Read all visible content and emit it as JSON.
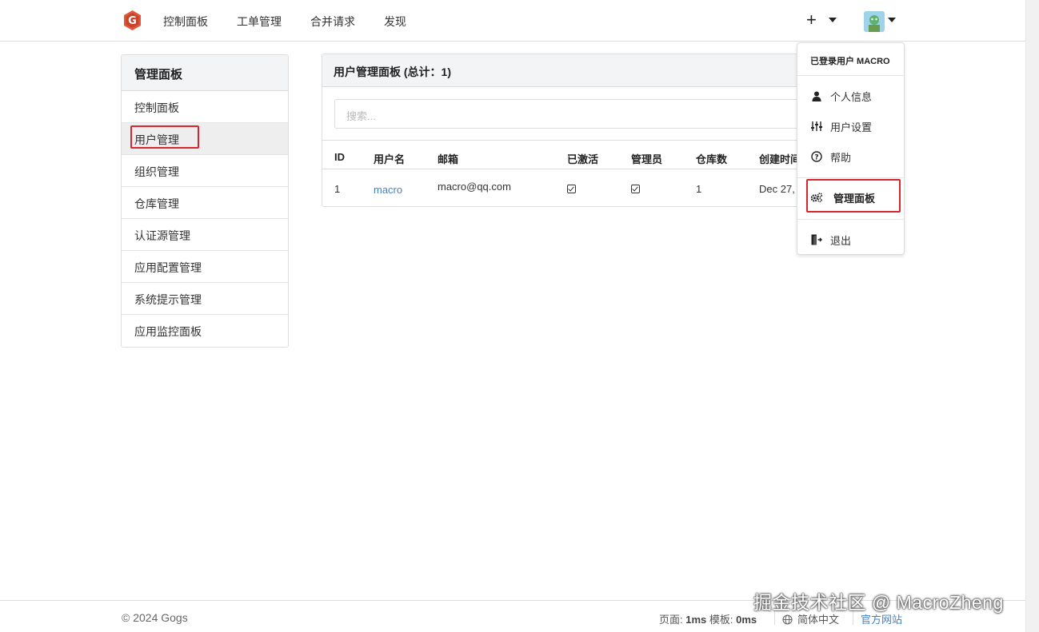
{
  "nav": {
    "items": [
      "控制面板",
      "工单管理",
      "合并请求",
      "发现"
    ],
    "plus_label": "+"
  },
  "sidebar": {
    "header": "管理面板",
    "items": [
      {
        "label": "控制面板"
      },
      {
        "label": "用户管理"
      },
      {
        "label": "组织管理"
      },
      {
        "label": "仓库管理"
      },
      {
        "label": "认证源管理"
      },
      {
        "label": "应用配置管理"
      },
      {
        "label": "系统提示管理"
      },
      {
        "label": "应用监控面板"
      }
    ]
  },
  "panel": {
    "title": "用户管理面板 (总计：1)",
    "search_placeholder": "搜索...",
    "columns": [
      "ID",
      "用户名",
      "邮箱",
      "已激活",
      "管理员",
      "仓库数",
      "创建时间"
    ],
    "rows": [
      {
        "id": "1",
        "username": "macro",
        "email": "macro@qq.com",
        "activated": true,
        "admin": true,
        "repos": "1",
        "created": "Dec 27,"
      }
    ]
  },
  "dropdown": {
    "header": "已登录用户 MACRO",
    "items": [
      {
        "label": "个人信息",
        "icon": "user-icon"
      },
      {
        "label": "用户设置",
        "icon": "sliders-icon"
      },
      {
        "label": "帮助",
        "icon": "help-circle-icon"
      },
      {
        "label": "管理面板",
        "icon": "cogs-icon"
      },
      {
        "label": "退出",
        "icon": "sign-out-icon"
      }
    ]
  },
  "footer": {
    "copyright": "© 2024 Gogs",
    "page_label": "页面: ",
    "page_time": "1ms",
    "template_label": " 模板: ",
    "template_time": "0ms",
    "language": "简体中文",
    "official_site": "官方网站"
  },
  "watermark": "掘金技术社区 @ MacroZheng",
  "colors": {
    "link": "#4183c4",
    "highlight_border": "#d8252d",
    "logo": "#e0573a"
  }
}
